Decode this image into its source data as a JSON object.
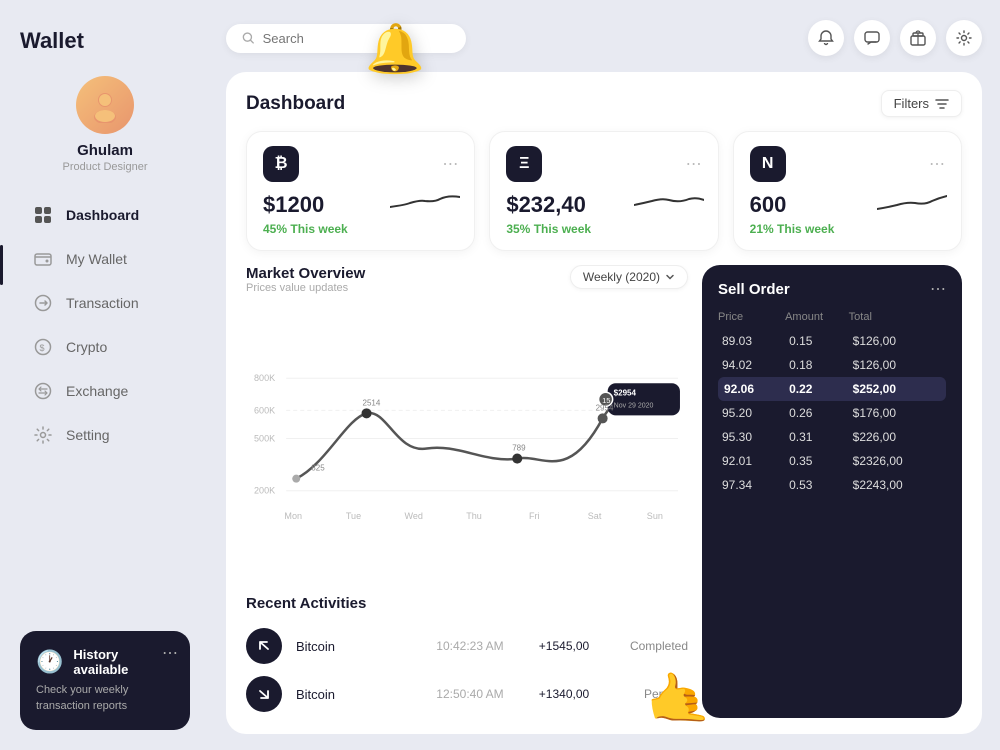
{
  "sidebar": {
    "title": "Wallet",
    "user": {
      "name": "Ghulam",
      "role": "Product Designer",
      "avatar_emoji": "👤"
    },
    "nav": [
      {
        "id": "dashboard",
        "label": "Dashboard",
        "icon": "⊞",
        "active": true
      },
      {
        "id": "mywallet",
        "label": "My Wallet",
        "icon": "🪪",
        "active": false
      },
      {
        "id": "transaction",
        "label": "Transaction",
        "icon": "🔄",
        "active": false
      },
      {
        "id": "crypto",
        "label": "Crypto",
        "icon": "💲",
        "active": false
      },
      {
        "id": "exchange",
        "label": "Exchange",
        "icon": "↔",
        "active": false
      },
      {
        "id": "setting",
        "label": "Setting",
        "icon": "⚙",
        "active": false
      }
    ],
    "history_card": {
      "title": "History available",
      "description": "Check your weekly transaction reports"
    }
  },
  "topbar": {
    "search_placeholder": "Search",
    "icons": [
      "🔔",
      "💬",
      "🎁",
      "⚙"
    ]
  },
  "dashboard": {
    "title": "Dashboard",
    "filters_label": "Filters",
    "cards": [
      {
        "id": "bitcoin",
        "symbol": "₿",
        "amount": "$1200",
        "change": "45%",
        "period": "This week"
      },
      {
        "id": "ethereum",
        "symbol": "Ξ",
        "amount": "$232,40",
        "change": "35%",
        "period": "This week"
      },
      {
        "id": "near",
        "symbol": "N",
        "amount": "600",
        "change": "21%",
        "period": "This week"
      }
    ]
  },
  "market": {
    "title": "Market Overview",
    "subtitle": "Prices value updates",
    "period_label": "Weekly (2020)",
    "chart": {
      "days": [
        "Mon",
        "Tue",
        "Wed",
        "Thu",
        "Fri",
        "Sat",
        "Sun"
      ],
      "y_labels": [
        "800K",
        "600K",
        "500K",
        "200K"
      ],
      "data_labels": [
        "825",
        "2514",
        "",
        "789",
        "",
        "2954",
        ""
      ],
      "tooltip": {
        "value": "$2954",
        "date": "Nov 29 2020",
        "dot": "15"
      }
    }
  },
  "sell_order": {
    "title": "Sell Order",
    "columns": [
      "Price",
      "Amount",
      "Total"
    ],
    "rows": [
      {
        "price": "89.03",
        "amount": "0.15",
        "total": "$126,00",
        "highlight": false
      },
      {
        "price": "94.02",
        "amount": "0.18",
        "total": "$126,00",
        "highlight": false
      },
      {
        "price": "92.06",
        "amount": "0.22",
        "total": "$252,00",
        "highlight": true
      },
      {
        "price": "95.20",
        "amount": "0.26",
        "total": "$176,00",
        "highlight": false
      },
      {
        "price": "95.30",
        "amount": "0.31",
        "total": "$226,00",
        "highlight": false
      },
      {
        "price": "92.01",
        "amount": "0.35",
        "total": "$2326,00",
        "highlight": false
      },
      {
        "price": "97.34",
        "amount": "0.53",
        "total": "$2243,00",
        "highlight": false
      }
    ]
  },
  "recent": {
    "title": "Recent Activities",
    "items": [
      {
        "icon": "↗",
        "name": "Bitcoin",
        "time": "10:42:23 AM",
        "amount": "+1545,00",
        "status": "Completed",
        "up": true
      },
      {
        "icon": "↙",
        "name": "Bitcoin",
        "time": "12:50:40 AM",
        "amount": "+1340,00",
        "status": "Pending",
        "up": false
      }
    ]
  },
  "colors": {
    "dark": "#1a1a2e",
    "bg": "#e8eaf2",
    "white": "#ffffff",
    "accent_green": "#4caf50"
  }
}
